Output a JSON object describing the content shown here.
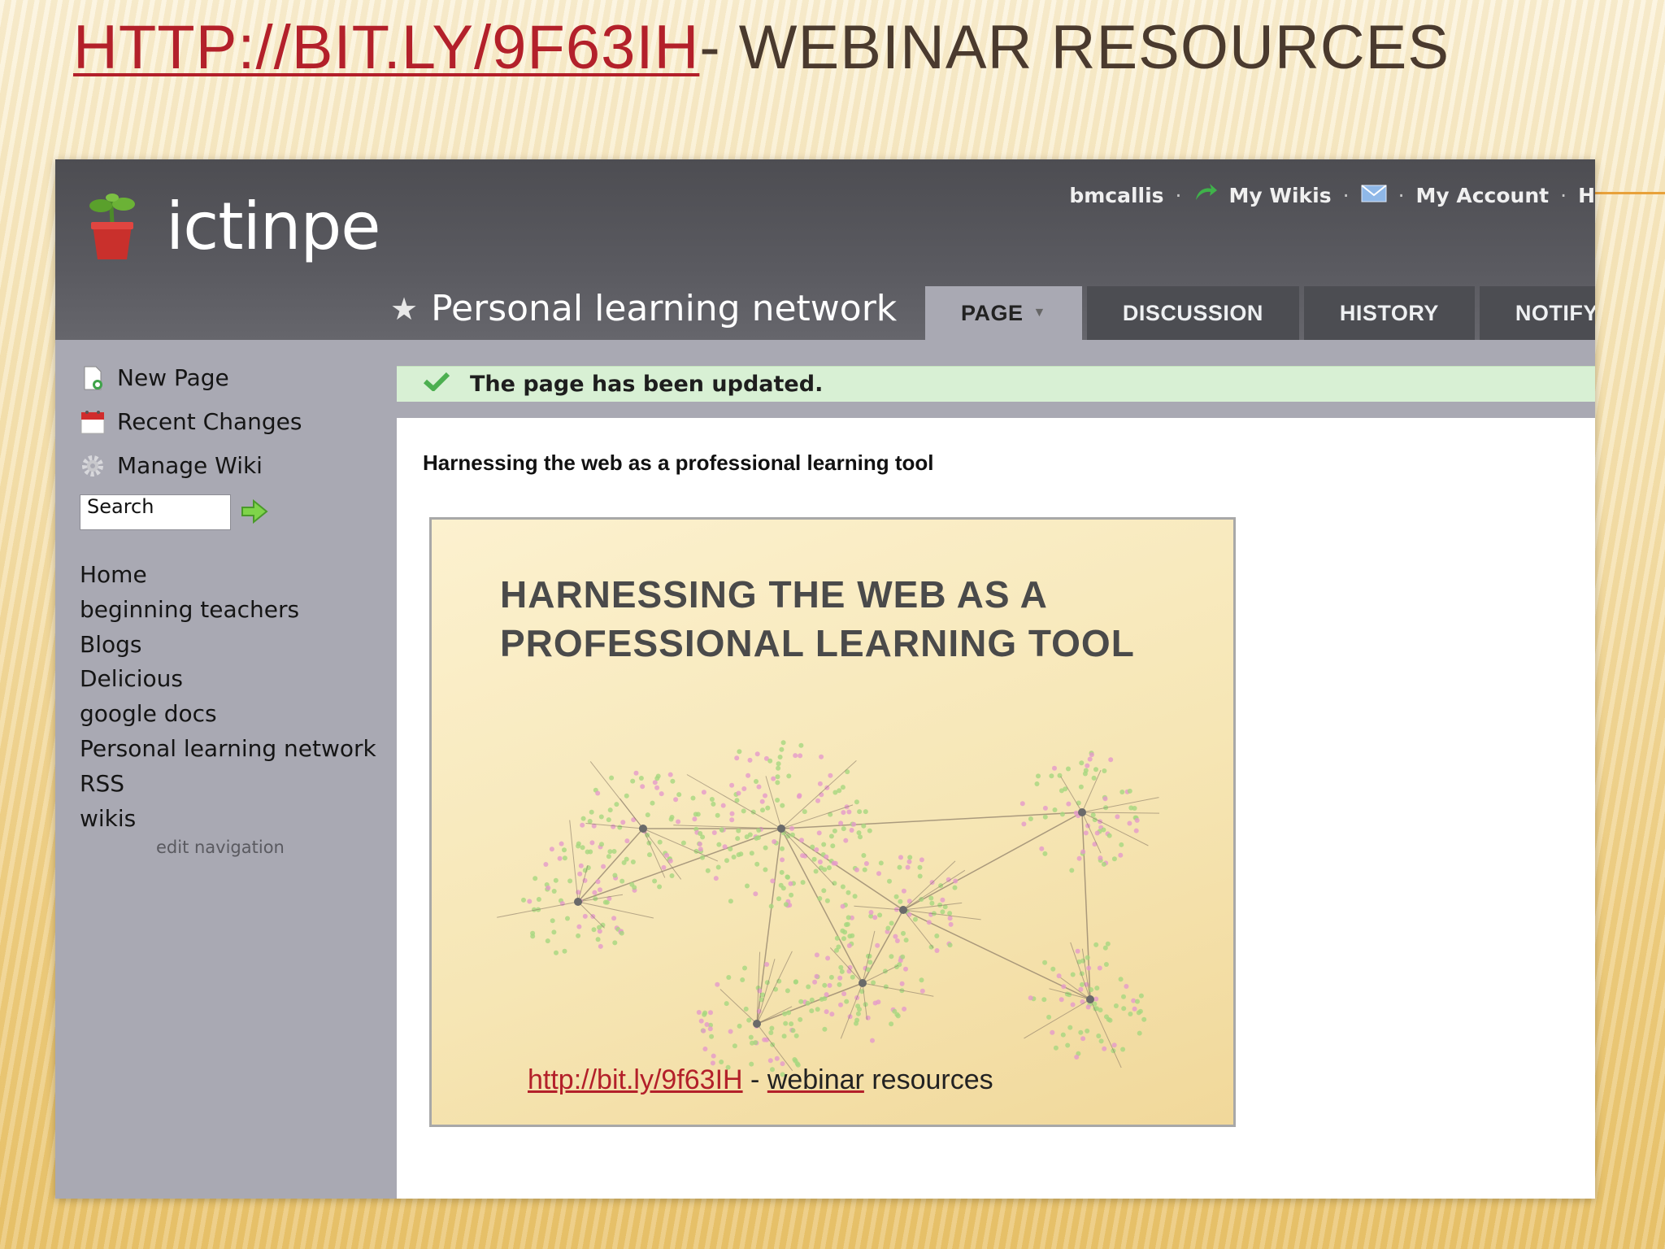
{
  "slide": {
    "title_link": "HTTP://BIT.LY/9F63IH",
    "title_suffix": "- WEBINAR RESOURCES"
  },
  "wiki": {
    "site_name": "ictinpe",
    "usernav": {
      "username": "bmcallis",
      "my_wikis": "My Wikis",
      "my_account": "My Account",
      "truncated": "H"
    },
    "page_title": "Personal learning network",
    "tabs": [
      {
        "label": "PAGE",
        "active": true
      },
      {
        "label": "DISCUSSION",
        "active": false
      },
      {
        "label": "HISTORY",
        "active": false
      },
      {
        "label": "NOTIFY M",
        "active": false
      }
    ],
    "sidebar": {
      "actions": [
        {
          "label": "New Page",
          "icon": "new-page-icon"
        },
        {
          "label": "Recent Changes",
          "icon": "calendar-icon"
        },
        {
          "label": "Manage Wiki",
          "icon": "gear-icon"
        }
      ],
      "search_value": "Search",
      "nav_items": [
        "Home",
        "beginning teachers",
        "Blogs",
        "Delicious",
        "google docs",
        "Personal learning network",
        "RSS",
        "wikis"
      ],
      "edit_navigation": "edit navigation"
    },
    "notice": "The page has been updated.",
    "content_heading": "Harnessing the web as a professional learning tool",
    "embed": {
      "title_line1": "HARNESSING THE WEB AS A",
      "title_line2": "PROFESSIONAL LEARNING TOOL",
      "footer_link": "http://bit.ly/9f63IH",
      "footer_dash": " - ",
      "footer_text_1": "webinar",
      "footer_text_2": " resources"
    }
  },
  "colors": {
    "title_link": "#b3202a",
    "title_text": "#4a3a2e",
    "header_bg": "#56565b",
    "sidebar_bg": "#a9a9b3",
    "notice_bg": "#d8f0d4",
    "accent_orange": "#e8a13a"
  }
}
